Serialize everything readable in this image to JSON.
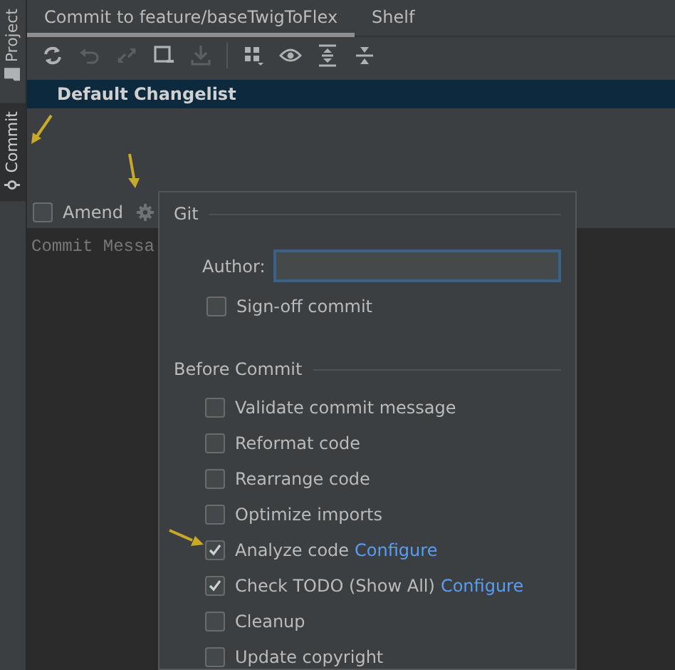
{
  "sidebar": {
    "tabs": [
      {
        "label": "Project",
        "kind": "folder",
        "selected": false
      },
      {
        "label": "Commit",
        "kind": "commit",
        "selected": true
      }
    ]
  },
  "tabs": [
    {
      "label": "Commit to feature/baseTwigToFlex",
      "selected": true
    },
    {
      "label": "Shelf",
      "selected": false
    }
  ],
  "toolbar": [
    {
      "kind": "refresh",
      "disabled": false
    },
    {
      "kind": "rollback",
      "disabled": true
    },
    {
      "kind": "diff",
      "disabled": true
    },
    {
      "kind": "shelve",
      "disabled": false
    },
    {
      "kind": "download",
      "disabled": true
    },
    {
      "kind": "separator"
    },
    {
      "kind": "group",
      "disabled": false
    },
    {
      "kind": "eye",
      "disabled": false
    },
    {
      "kind": "expand",
      "disabled": false
    },
    {
      "kind": "collapse",
      "disabled": false
    }
  ],
  "changelist": {
    "name": "Default Changelist",
    "selected": true
  },
  "amend": {
    "label": "Amend",
    "checked": false
  },
  "commit_message": {
    "placeholder": "Commit Messa"
  },
  "popup": {
    "git": {
      "title": "Git",
      "author_label": "Author:",
      "signoff": {
        "label": "Sign-off commit",
        "checked": false
      }
    },
    "before_commit": {
      "title": "Before Commit",
      "options": [
        {
          "label": "Validate commit message",
          "checked": false
        },
        {
          "label": "Reformat code",
          "checked": false
        },
        {
          "label": "Rearrange code",
          "checked": false
        },
        {
          "label": "Optimize imports",
          "checked": false
        },
        {
          "label": "Analyze code",
          "checked": true,
          "link": "Configure"
        },
        {
          "label": "Check TODO (Show All)",
          "checked": true,
          "link": "Configure"
        },
        {
          "label": "Cleanup",
          "checked": false
        },
        {
          "label": "Update copyright",
          "checked": false
        }
      ]
    }
  }
}
